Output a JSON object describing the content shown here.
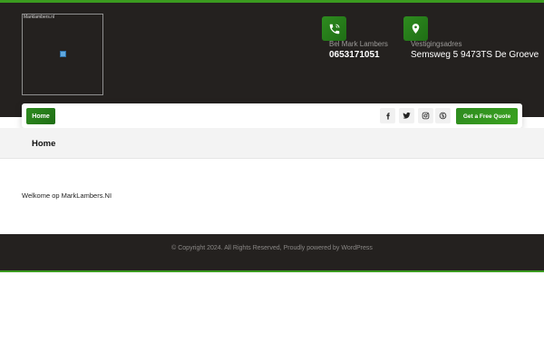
{
  "header": {
    "logo": {
      "alt_text": "Marklambers.nl",
      "image_icon": "image-placeholder-icon"
    },
    "phone": {
      "icon": "phone-icon",
      "label": "Bel Mark Lambers",
      "value": "0653171051"
    },
    "address": {
      "icon": "map-marker-icon",
      "label": "Vestigingsadres",
      "value": "Semsweg 5 9473TS De Groeve"
    }
  },
  "nav": {
    "home_label": "Home",
    "social": [
      {
        "icon": "facebook-icon"
      },
      {
        "icon": "twitter-icon"
      },
      {
        "icon": "instagram-icon"
      },
      {
        "icon": "skype-icon"
      }
    ],
    "quote_label": "Get a Free Quote"
  },
  "page": {
    "title": "Home",
    "content": "Welkome op MarkLambers.NI"
  },
  "footer": {
    "text": "© Copyright 2024. All Rights Reserved, Proudly powered by WordPress"
  },
  "colors": {
    "accent": "#3b9b1f",
    "header_bg": "#24211f"
  }
}
